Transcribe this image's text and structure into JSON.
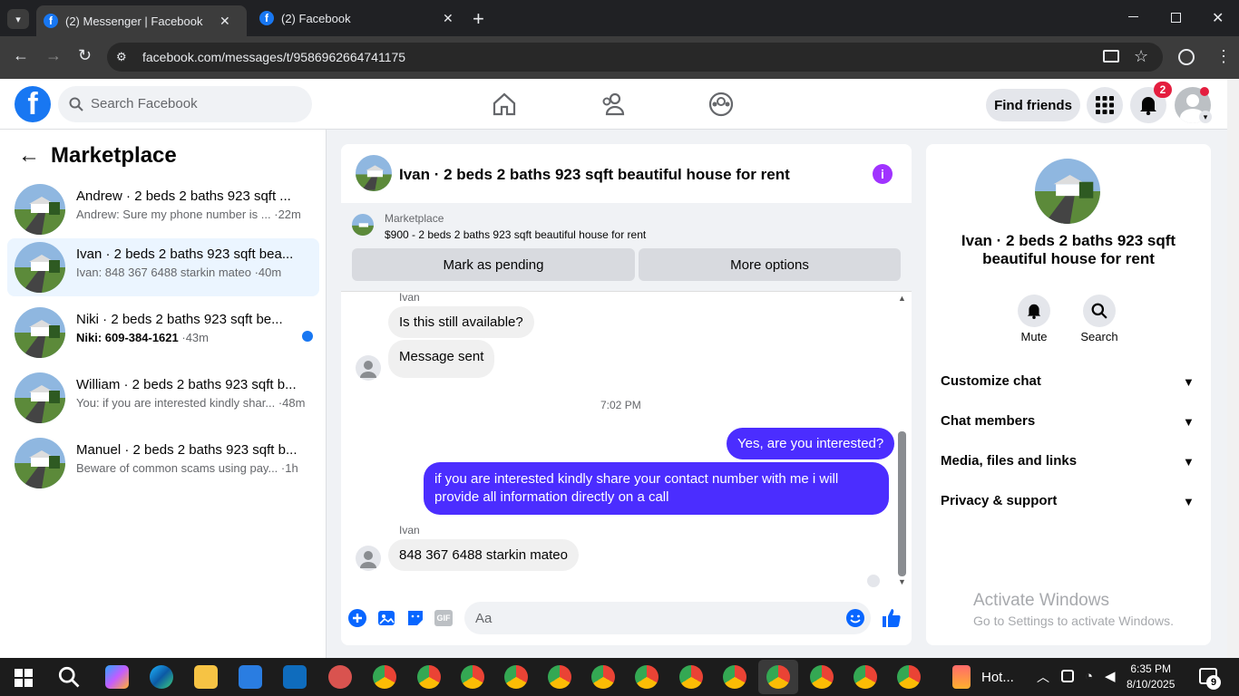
{
  "browser": {
    "tabs": [
      {
        "title": "(2) Messenger | Facebook"
      },
      {
        "title": "(2) Facebook"
      }
    ],
    "url": "facebook.com/messages/t/9586962664741175",
    "new_tab_symbol": "+",
    "close_symbol": "✕"
  },
  "fb_header": {
    "search_placeholder": "Search Facebook",
    "find_friends_label": "Find friends",
    "notif_count": "2",
    "logo_letter": "f"
  },
  "sidebar": {
    "title": "Marketplace",
    "conversations": [
      {
        "name": "Andrew · 2 beds 2 baths 923 sqft ...",
        "preview": "Andrew: Sure my phone number is ...",
        "time": "·22m",
        "unread": false,
        "selected": false
      },
      {
        "name": "Ivan · 2 beds 2 baths 923 sqft bea...",
        "preview": "Ivan: 848 367 6488 starkin mateo",
        "time": "·40m",
        "unread": false,
        "selected": true
      },
      {
        "name": "Niki · 2 beds 2 baths 923 sqft be...",
        "preview": "Niki: 609-384-1621",
        "time": "·43m",
        "unread": true,
        "selected": false
      },
      {
        "name": "William · 2 beds 2 baths 923 sqft b...",
        "preview": "You: if you are interested kindly shar...",
        "time": "·48m",
        "unread": false,
        "selected": false
      },
      {
        "name": "Manuel · 2 beds 2 baths 923 sqft b...",
        "preview": "Beware of common scams using pay...",
        "time": "·1h",
        "unread": false,
        "selected": false
      }
    ]
  },
  "chat": {
    "title": "Ivan · 2 beds 2 baths 923 sqft beautiful house for rent",
    "marketplace_label": "Marketplace",
    "listing": "$900 - 2 beds 2 baths 923 sqft beautiful house for rent",
    "mark_pending": "Mark as pending",
    "more_options": "More options",
    "info_symbol": "i",
    "messages": {
      "sender1": "Ivan",
      "in1": "Is this still available?",
      "in2": "Message sent",
      "timestamp": "7:02 PM",
      "out1": "Yes, are you interested?",
      "out2": "if you are interested kindly share your contact number with me i will provide all information directly on a call",
      "sender2": "Ivan",
      "in3": "848 367 6488 starkin mateo"
    },
    "composer_placeholder": "Aa",
    "gif_label": "GIF"
  },
  "details": {
    "name": "Ivan · 2 beds 2 baths 923 sqft beautiful house for rent",
    "mute": "Mute",
    "search": "Search",
    "sections": [
      "Customize chat",
      "Chat members",
      "Media, files and links",
      "Privacy & support"
    ]
  },
  "watermark": {
    "line1": "Activate Windows",
    "line2": "Go to Settings to activate Windows."
  },
  "taskbar": {
    "weather": "Hot...",
    "time": "6:35 PM",
    "date": "8/10/2025",
    "badge": "9"
  },
  "colors": {
    "fb_blue": "#1877f2",
    "outgoing_bubble": "#4b2dff",
    "selected_row": "#ebf5ff"
  }
}
